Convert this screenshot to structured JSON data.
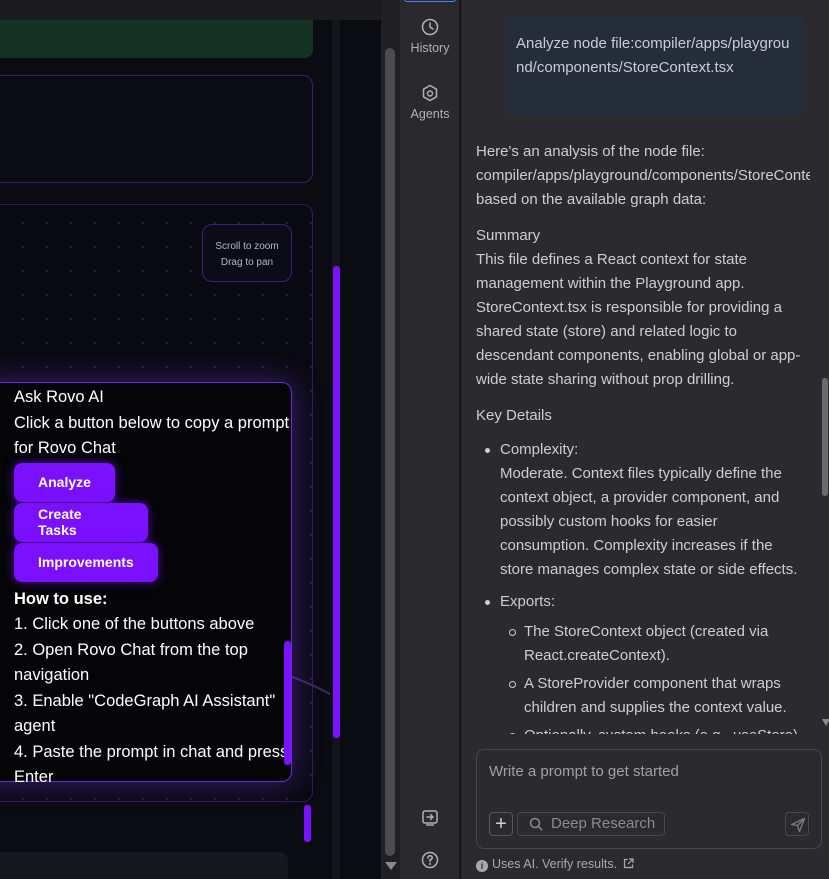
{
  "canvas": {
    "zoom_hint_line1": "Scroll to zoom",
    "zoom_hint_line2": "Drag to pan"
  },
  "ask_card": {
    "title": "Ask Rovo AI",
    "subtitle": "Click a button below to copy a prompt for Rovo Chat",
    "buttons": [
      "Analyze",
      "Create Tasks",
      "Improvements"
    ],
    "how_to_title": "How to use:",
    "steps": [
      "1. Click one of the buttons above",
      "2. Open Rovo Chat from the top navigation",
      "3. Enable \"CodeGraph AI Assistant\" agent",
      "4. Paste the prompt in chat and press Enter"
    ]
  },
  "sidenav": {
    "items": [
      {
        "label": "History",
        "icon": "clock-icon"
      },
      {
        "label": "Agents",
        "icon": "agents-icon"
      }
    ],
    "bottom_icons": [
      "exit-panel-icon",
      "help-icon"
    ]
  },
  "chat": {
    "user_message": "Analyze node file:compiler/apps/playground/components/StoreContext.tsx",
    "intro": "Here's an analysis of the node file: compiler/apps/playground/components/StoreContext.tsx based on the available graph data:",
    "summary_title": "Summary",
    "summary_text": "This file defines a React context for state management within the Playground app. StoreContext.tsx is responsible for providing a shared state (store) and related logic to descendant components, enabling global or app-wide state sharing without prop drilling.",
    "key_details_title": "Key Details",
    "complexity_label": "Complexity:",
    "complexity_text": "Moderate. Context files typically define the context object, a provider component, and possibly custom hooks for easier consumption. Complexity increases if the store manages complex state or side effects.",
    "exports_label": "Exports:",
    "exports": [
      "The StoreContext object (created via React.createContext).",
      "A StoreProvider component that wraps children and supplies the context value.",
      "Optionally, custom hooks (e.g., useStore)"
    ],
    "composer_placeholder": "Write a prompt to get started",
    "deep_research_label": "Deep Research",
    "disclaimer": "Uses AI. Verify results."
  },
  "colors": {
    "accent_purple": "#7a10ff",
    "chat_bg": "#2b2b2f",
    "user_bubble": "#252d3b",
    "canvas_bg": "#0b0b12"
  }
}
